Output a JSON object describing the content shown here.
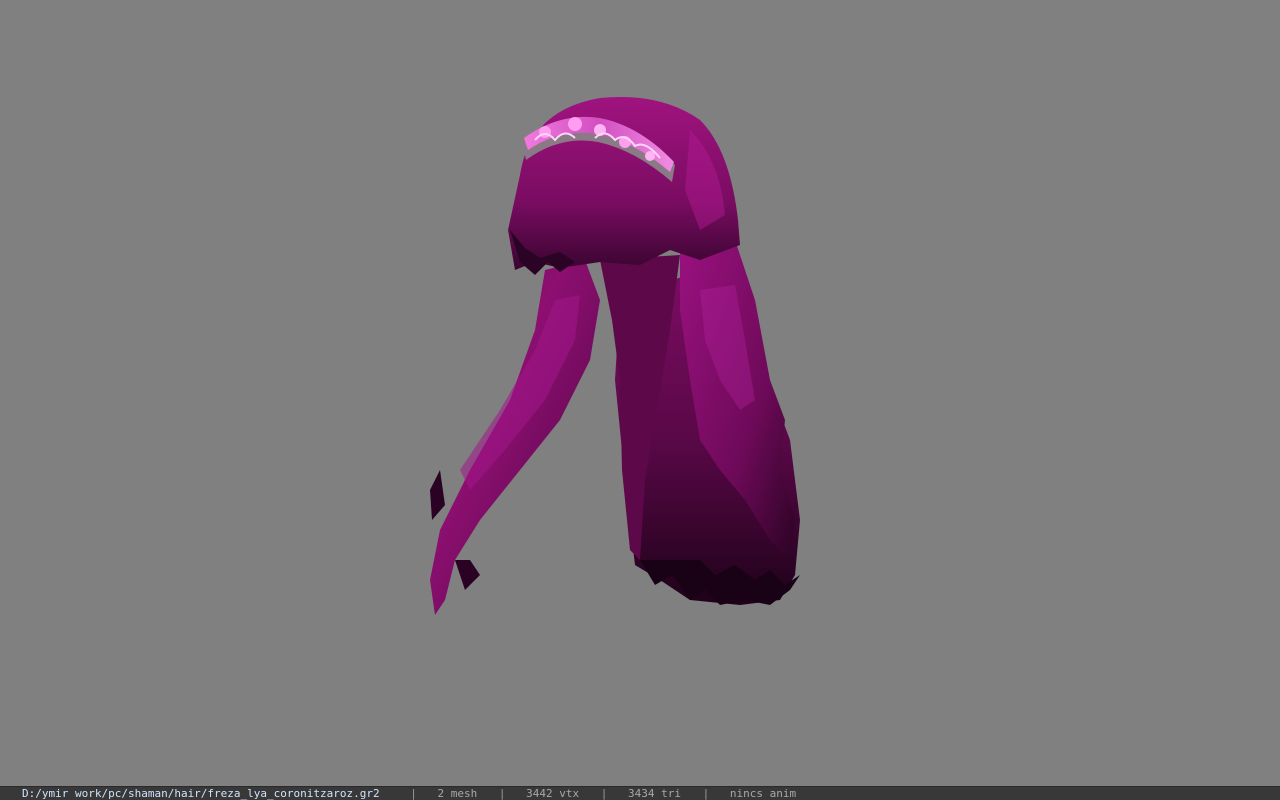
{
  "viewport": {
    "background_color": "#808080",
    "model_name": "hair model with tiara",
    "hair_color": "#8a0f6e",
    "tiara_color": "#e06ad0"
  },
  "statusbar": {
    "file_path": "D:/ymir work/pc/shaman/hair/freza_lya_coronitzaroz.gr2",
    "separator": "|",
    "mesh_count": "2 mesh",
    "vertex_count": "3442 vtx",
    "triangle_count": "3434 tri",
    "anim_status": "nincs anim"
  }
}
